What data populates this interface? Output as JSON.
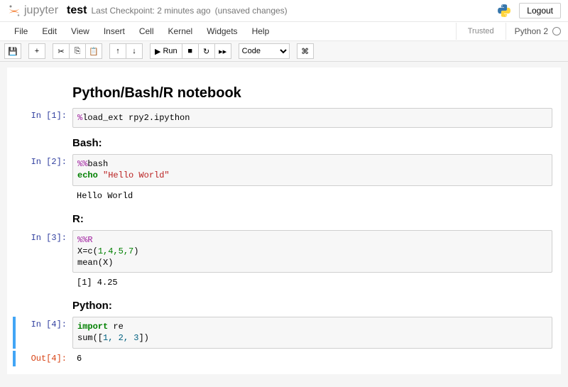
{
  "header": {
    "logo_text": "jupyter",
    "title": "test",
    "checkpoint": "Last Checkpoint: 2 minutes ago",
    "unsaved": "(unsaved changes)",
    "logout": "Logout"
  },
  "menu": {
    "file": "File",
    "edit": "Edit",
    "view": "View",
    "insert": "Insert",
    "cell": "Cell",
    "kernel": "Kernel",
    "widgets": "Widgets",
    "help": "Help",
    "trusted": "Trusted",
    "kernel_name": "Python 2"
  },
  "toolbar": {
    "run_label": "Run",
    "celltype": "Code",
    "icons": {
      "save": "💾",
      "add": "+",
      "cut": "✂",
      "copy": "⎘",
      "paste": "📋",
      "up": "↑",
      "down": "↓",
      "runplay": "▶",
      "stop": "■",
      "restart": "↻",
      "fastfwd": "▸▸",
      "palette": "⌘"
    }
  },
  "cells": {
    "title": "Python/Bash/R notebook",
    "c1": {
      "prompt": "In [1]:",
      "magic": "%",
      "rest": "load_ext rpy2.ipython"
    },
    "h_bash": "Bash:",
    "c2": {
      "prompt": "In [2]:",
      "l1a": "%%",
      "l1b": "bash",
      "l2a": "echo",
      "l2b": "\"Hello World\"",
      "out": "Hello World"
    },
    "h_r": "R:",
    "c3": {
      "prompt": "In [3]:",
      "l1": "%%R",
      "l2": "X=c(",
      "nums": "1,4,5,7",
      "l2end": ")",
      "l3": "mean(X)",
      "out": "[1] 4.25"
    },
    "h_py": "Python:",
    "c4": {
      "prompt": "In [4]:",
      "out_prompt": "Out[4]:",
      "kw": "import",
      "mod": " re",
      "l2a": "sum([",
      "nums": "1, 2, 3",
      "l2b": "])",
      "out": "6"
    }
  }
}
